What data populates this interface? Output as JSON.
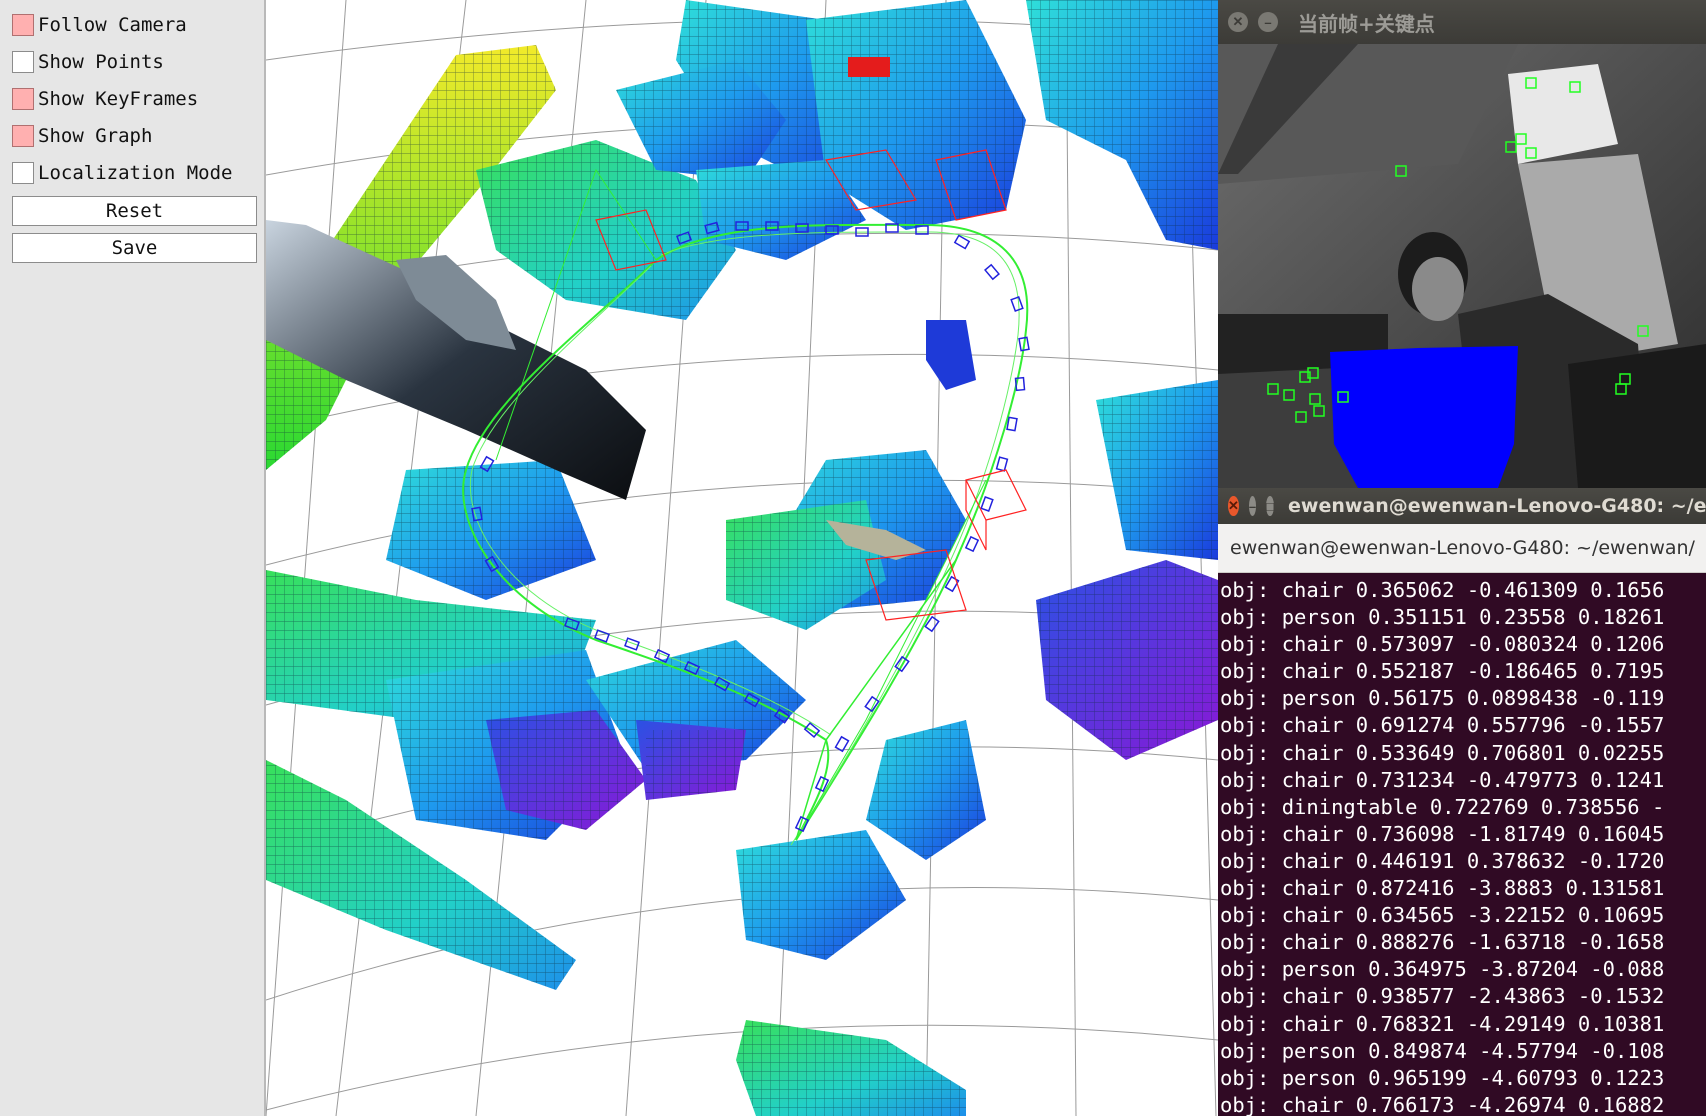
{
  "panel": {
    "checkboxes": [
      {
        "label": "Follow Camera",
        "checked": true
      },
      {
        "label": "Show Points",
        "checked": false
      },
      {
        "label": "Show KeyFrames",
        "checked": true
      },
      {
        "label": "Show Graph",
        "checked": true
      },
      {
        "label": "Localization Mode",
        "checked": false
      }
    ],
    "buttons": {
      "reset": "Reset",
      "save": "Save"
    }
  },
  "colors": {
    "checked_fill": "#ffb0b0",
    "trajectory": "#33ee33",
    "keyframe": "#2222dd",
    "terminal_bg": "#300a24",
    "person_mask": "#0000ff"
  },
  "frame_window": {
    "title": "当前帧+关键点",
    "buttons": [
      "close-icon",
      "minimize-icon"
    ]
  },
  "terminal": {
    "title": "ewenwan@ewenwan-Lenovo-G480: ~/ewenwan/",
    "tab_title": "ewenwan@ewenwan-Lenovo-G480: ~/ewenwan/",
    "lines": [
      "obj: chair 0.365062 -0.461309 0.1656",
      "obj: person 0.351151 0.23558 0.18261",
      "obj: chair 0.573097 -0.080324 0.1206",
      "obj: chair 0.552187 -0.186465 0.7195",
      "obj: person 0.56175 0.0898438 -0.119",
      "obj: chair 0.691274 0.557796 -0.1557",
      "obj: chair 0.533649 0.706801 0.02255",
      "obj: chair 0.731234 -0.479773 0.1241",
      "obj: diningtable 0.722769 0.738556 -",
      "obj: chair 0.736098 -1.81749 0.16045",
      "obj: chair 0.446191 0.378632 -0.1720",
      "obj: chair 0.872416 -3.8883 0.131581",
      "obj: chair 0.634565 -3.22152 0.10695",
      "obj: chair 0.888276 -1.63718 -0.1658",
      "obj: person 0.364975 -3.87204 -0.088",
      "obj: chair 0.938577 -2.43863 -0.1532",
      "obj: chair 0.768321 -4.29149 0.10381",
      "obj: person 0.849874 -4.57794 -0.108",
      "obj: person 0.965199 -4.60793 0.1223",
      "obj: chair 0.766173 -4.26974 0.16882"
    ]
  }
}
